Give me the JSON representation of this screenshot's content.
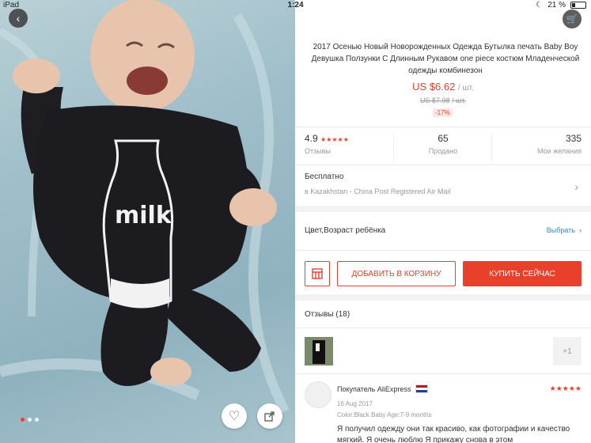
{
  "status_bar": {
    "device": "iPad",
    "time": "1:24",
    "battery": "21 %"
  },
  "gallery": {
    "print_text": "milk",
    "page_count": 3,
    "active_page": 1
  },
  "product": {
    "title": "2017 Осенью Новый Новорожденных Одежда Бутылка печать Baby Boy Девушка Ползунки С Длинным Рукавом one piece костюм Младенческой одежды комбинезон",
    "price": "US $6.62",
    "price_unit": "/ шт.",
    "old_price": "US $7.98",
    "old_price_unit": "/ шт.",
    "discount": "-17%"
  },
  "stats": {
    "rating": "4.9",
    "rating_label": "Отзывы",
    "orders": "65",
    "orders_label": "Продано",
    "wishlist": "335",
    "wishlist_label": "Мои желания"
  },
  "shipping": {
    "title": "Бесплатно",
    "detail": "в Kazakhstan - China Post Registered Air Mail"
  },
  "options": {
    "label": "Цвет,Возраст ребёнка",
    "choose": "Выбрать"
  },
  "actions": {
    "add_to_cart": "ДОБАВИТЬ В КОРЗИНУ",
    "buy_now": "КУПИТЬ СЕЙЧАС"
  },
  "reviews": {
    "header": "Отзывы (18)",
    "more_photos": "+1",
    "first": {
      "reviewer": "Покупатель AliExpress",
      "date": "16 Aug 2017",
      "sku": "Color:Black Baby Age:7-9 months",
      "text": "Я получил одежду они так красиво, как фотографии и качество мягкий. Я очень люблю Я прикажу снова в этом"
    }
  },
  "colors": {
    "accent": "#e8402b",
    "link": "#2d8fd5"
  }
}
